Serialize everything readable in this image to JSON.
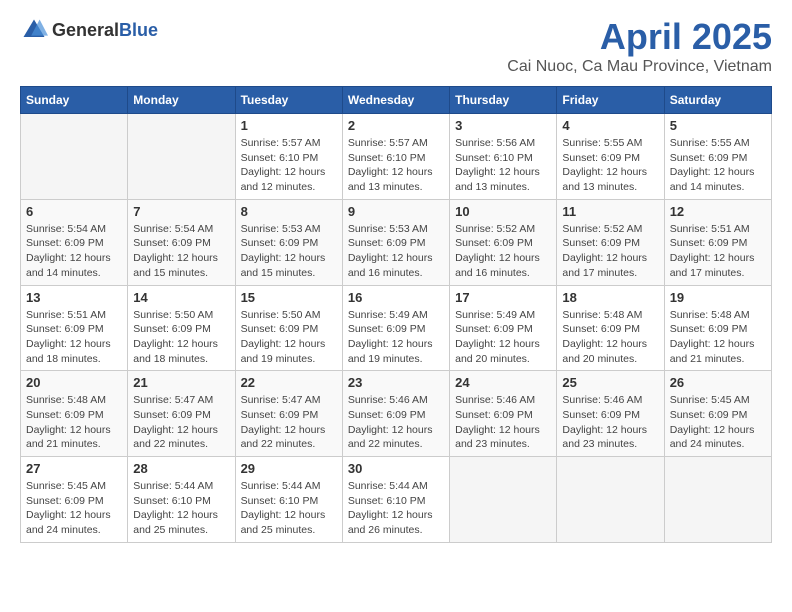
{
  "logo": {
    "general": "General",
    "blue": "Blue"
  },
  "header": {
    "title": "April 2025",
    "subtitle": "Cai Nuoc, Ca Mau Province, Vietnam"
  },
  "weekdays": [
    "Sunday",
    "Monday",
    "Tuesday",
    "Wednesday",
    "Thursday",
    "Friday",
    "Saturday"
  ],
  "weeks": [
    [
      {
        "day": "",
        "info": ""
      },
      {
        "day": "",
        "info": ""
      },
      {
        "day": "1",
        "info": "Sunrise: 5:57 AM\nSunset: 6:10 PM\nDaylight: 12 hours and 12 minutes."
      },
      {
        "day": "2",
        "info": "Sunrise: 5:57 AM\nSunset: 6:10 PM\nDaylight: 12 hours and 13 minutes."
      },
      {
        "day": "3",
        "info": "Sunrise: 5:56 AM\nSunset: 6:10 PM\nDaylight: 12 hours and 13 minutes."
      },
      {
        "day": "4",
        "info": "Sunrise: 5:55 AM\nSunset: 6:09 PM\nDaylight: 12 hours and 13 minutes."
      },
      {
        "day": "5",
        "info": "Sunrise: 5:55 AM\nSunset: 6:09 PM\nDaylight: 12 hours and 14 minutes."
      }
    ],
    [
      {
        "day": "6",
        "info": "Sunrise: 5:54 AM\nSunset: 6:09 PM\nDaylight: 12 hours and 14 minutes."
      },
      {
        "day": "7",
        "info": "Sunrise: 5:54 AM\nSunset: 6:09 PM\nDaylight: 12 hours and 15 minutes."
      },
      {
        "day": "8",
        "info": "Sunrise: 5:53 AM\nSunset: 6:09 PM\nDaylight: 12 hours and 15 minutes."
      },
      {
        "day": "9",
        "info": "Sunrise: 5:53 AM\nSunset: 6:09 PM\nDaylight: 12 hours and 16 minutes."
      },
      {
        "day": "10",
        "info": "Sunrise: 5:52 AM\nSunset: 6:09 PM\nDaylight: 12 hours and 16 minutes."
      },
      {
        "day": "11",
        "info": "Sunrise: 5:52 AM\nSunset: 6:09 PM\nDaylight: 12 hours and 17 minutes."
      },
      {
        "day": "12",
        "info": "Sunrise: 5:51 AM\nSunset: 6:09 PM\nDaylight: 12 hours and 17 minutes."
      }
    ],
    [
      {
        "day": "13",
        "info": "Sunrise: 5:51 AM\nSunset: 6:09 PM\nDaylight: 12 hours and 18 minutes."
      },
      {
        "day": "14",
        "info": "Sunrise: 5:50 AM\nSunset: 6:09 PM\nDaylight: 12 hours and 18 minutes."
      },
      {
        "day": "15",
        "info": "Sunrise: 5:50 AM\nSunset: 6:09 PM\nDaylight: 12 hours and 19 minutes."
      },
      {
        "day": "16",
        "info": "Sunrise: 5:49 AM\nSunset: 6:09 PM\nDaylight: 12 hours and 19 minutes."
      },
      {
        "day": "17",
        "info": "Sunrise: 5:49 AM\nSunset: 6:09 PM\nDaylight: 12 hours and 20 minutes."
      },
      {
        "day": "18",
        "info": "Sunrise: 5:48 AM\nSunset: 6:09 PM\nDaylight: 12 hours and 20 minutes."
      },
      {
        "day": "19",
        "info": "Sunrise: 5:48 AM\nSunset: 6:09 PM\nDaylight: 12 hours and 21 minutes."
      }
    ],
    [
      {
        "day": "20",
        "info": "Sunrise: 5:48 AM\nSunset: 6:09 PM\nDaylight: 12 hours and 21 minutes."
      },
      {
        "day": "21",
        "info": "Sunrise: 5:47 AM\nSunset: 6:09 PM\nDaylight: 12 hours and 22 minutes."
      },
      {
        "day": "22",
        "info": "Sunrise: 5:47 AM\nSunset: 6:09 PM\nDaylight: 12 hours and 22 minutes."
      },
      {
        "day": "23",
        "info": "Sunrise: 5:46 AM\nSunset: 6:09 PM\nDaylight: 12 hours and 22 minutes."
      },
      {
        "day": "24",
        "info": "Sunrise: 5:46 AM\nSunset: 6:09 PM\nDaylight: 12 hours and 23 minutes."
      },
      {
        "day": "25",
        "info": "Sunrise: 5:46 AM\nSunset: 6:09 PM\nDaylight: 12 hours and 23 minutes."
      },
      {
        "day": "26",
        "info": "Sunrise: 5:45 AM\nSunset: 6:09 PM\nDaylight: 12 hours and 24 minutes."
      }
    ],
    [
      {
        "day": "27",
        "info": "Sunrise: 5:45 AM\nSunset: 6:09 PM\nDaylight: 12 hours and 24 minutes."
      },
      {
        "day": "28",
        "info": "Sunrise: 5:44 AM\nSunset: 6:10 PM\nDaylight: 12 hours and 25 minutes."
      },
      {
        "day": "29",
        "info": "Sunrise: 5:44 AM\nSunset: 6:10 PM\nDaylight: 12 hours and 25 minutes."
      },
      {
        "day": "30",
        "info": "Sunrise: 5:44 AM\nSunset: 6:10 PM\nDaylight: 12 hours and 26 minutes."
      },
      {
        "day": "",
        "info": ""
      },
      {
        "day": "",
        "info": ""
      },
      {
        "day": "",
        "info": ""
      }
    ]
  ]
}
